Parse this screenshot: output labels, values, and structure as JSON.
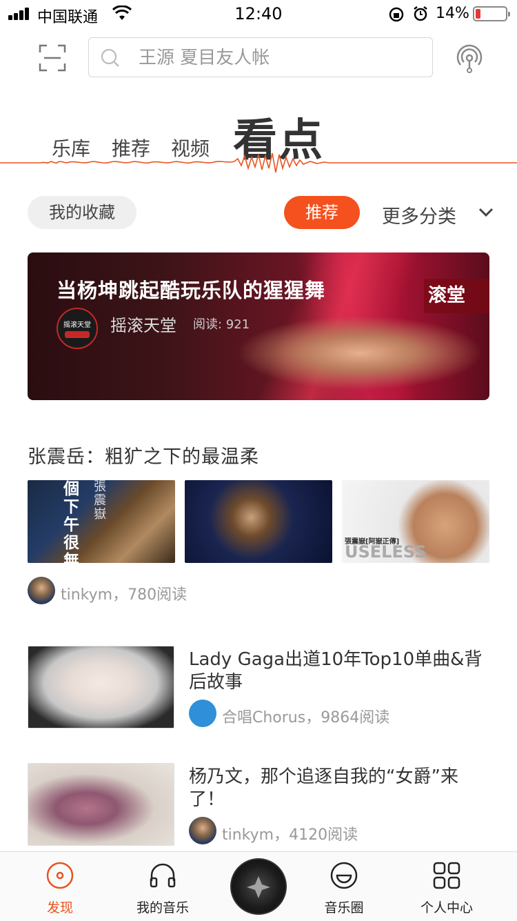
{
  "status_bar": {
    "carrier": "中国联通",
    "time": "12:40",
    "battery": "14%"
  },
  "header": {
    "search_placeholder": "王源 夏目友人帐"
  },
  "category_tabs": [
    {
      "label": "乐库"
    },
    {
      "label": "推荐"
    },
    {
      "label": "视频"
    },
    {
      "label": "看点"
    }
  ],
  "filters": {
    "favorites": "我的收藏",
    "recommended": "推荐",
    "more": "更多分类"
  },
  "banner": {
    "title": "当杨坤跳起酷玩乐队的猩猩舞",
    "author": "摇滚天堂",
    "reads": "阅读: 921",
    "badge": "滚堂",
    "avatar_text": "摇滚天堂"
  },
  "section1": {
    "title": "张震岳：粗犷之下的最温柔",
    "thumb1_text": "個下午很無聊",
    "thumb1_side": "張震嶽",
    "thumb3_text": "USELESS",
    "thumb3_caption": "張震嶽[阿嶽正傳]",
    "meta": "tinkym，780阅读"
  },
  "list": [
    {
      "title": "Lady Gaga出道10年Top10单曲&背后故事",
      "meta": "合唱Chorus，9864阅读"
    },
    {
      "title": "杨乃文，那个追逐自我的“女爵”来了！",
      "meta": "tinkym，4120阅读"
    }
  ],
  "tabbar": {
    "discover": "发现",
    "my_music": "我的音乐",
    "circle": "音乐圈",
    "profile": "个人中心"
  },
  "colors": {
    "accent": "#f4511e",
    "tab_active": "#e8531f"
  },
  "icons": [
    "signal-icon",
    "wifi-icon",
    "lock-rotation-icon",
    "alarm-icon",
    "battery-icon",
    "scan-icon",
    "search-icon",
    "radio-icon",
    "chevron-down-icon",
    "disc-icon",
    "headphones-icon",
    "smile-icon",
    "grid-icon"
  ]
}
